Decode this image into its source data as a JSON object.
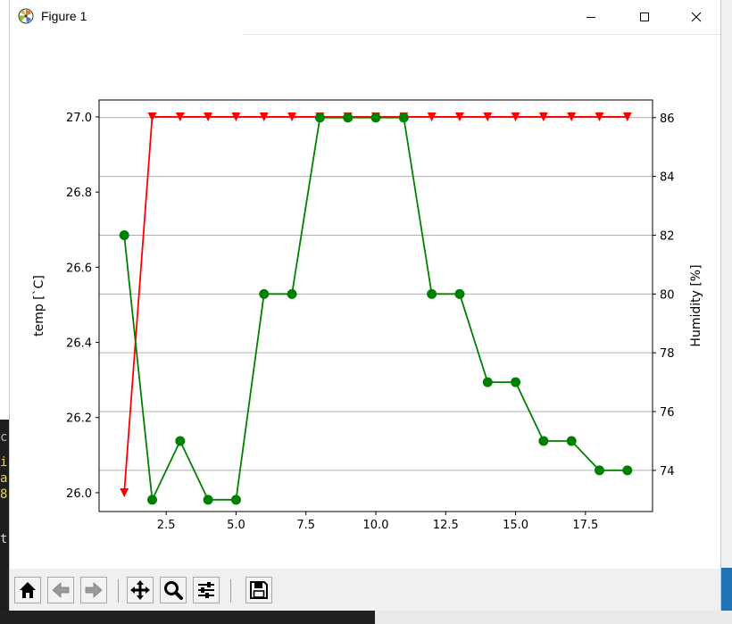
{
  "window": {
    "title": "Figure 1",
    "controls": [
      "minimize",
      "maximize",
      "close"
    ]
  },
  "background": {
    "terminal_fragments": [
      "c",
      "i",
      "a",
      "8",
      "t"
    ]
  },
  "toolbar": {
    "buttons": [
      {
        "name": "home",
        "icon": "home-icon"
      },
      {
        "name": "back",
        "icon": "arrow-left-icon"
      },
      {
        "name": "forward",
        "icon": "arrow-right-icon"
      },
      {
        "name": "pan",
        "icon": "move-arrows-icon"
      },
      {
        "name": "zoom",
        "icon": "magnifier-icon"
      },
      {
        "name": "configure-subplots",
        "icon": "sliders-icon"
      },
      {
        "name": "save",
        "icon": "floppy-disk-icon"
      }
    ]
  },
  "chart_data": {
    "type": "line",
    "title": "",
    "xlabel": "",
    "ylabel": "temp [`C]",
    "ylabel_right": "Humidity [%]",
    "xlim": [
      0.1,
      19.9
    ],
    "ylim": [
      25.95,
      27.045
    ],
    "ylim_right": [
      72.6,
      86.6
    ],
    "x_ticks": [
      "2.5",
      "5.0",
      "7.5",
      "10.0",
      "12.5",
      "15.0",
      "17.5"
    ],
    "x_tick_values": [
      2.5,
      5.0,
      7.5,
      10.0,
      12.5,
      15.0,
      17.5
    ],
    "y_ticks": [
      "26.0",
      "26.2",
      "26.4",
      "26.6",
      "26.8",
      "27.0"
    ],
    "y_tick_values": [
      26.0,
      26.2,
      26.4,
      26.6,
      26.8,
      27.0
    ],
    "y_ticks_right": [
      "74",
      "76",
      "78",
      "80",
      "82",
      "84",
      "86"
    ],
    "y_tick_values_right": [
      74,
      76,
      78,
      80,
      82,
      84,
      86
    ],
    "grid": "horizontal (right axis)",
    "series": [
      {
        "axis": "left",
        "color": "#ff0000",
        "marker": "triangle-down",
        "x": [
          1,
          2,
          3,
          4,
          5,
          6,
          7,
          8,
          9,
          10,
          11,
          12,
          13,
          14,
          15,
          16,
          17,
          18,
          19
        ],
        "values": [
          26.0,
          27.0,
          27.0,
          27.0,
          27.0,
          27.0,
          27.0,
          27.0,
          27.0,
          27.0,
          27.0,
          27.0,
          27.0,
          27.0,
          27.0,
          27.0,
          27.0,
          27.0,
          27.0
        ]
      },
      {
        "axis": "right",
        "color": "#008000",
        "marker": "circle",
        "x": [
          1,
          2,
          3,
          4,
          5,
          6,
          7,
          8,
          9,
          10,
          11,
          12,
          13,
          14,
          15,
          16,
          17,
          18,
          19
        ],
        "values": [
          82,
          73,
          75,
          73,
          73,
          80,
          80,
          86,
          86,
          86,
          86,
          80,
          80,
          77,
          77,
          75,
          75,
          74,
          74
        ]
      }
    ]
  }
}
